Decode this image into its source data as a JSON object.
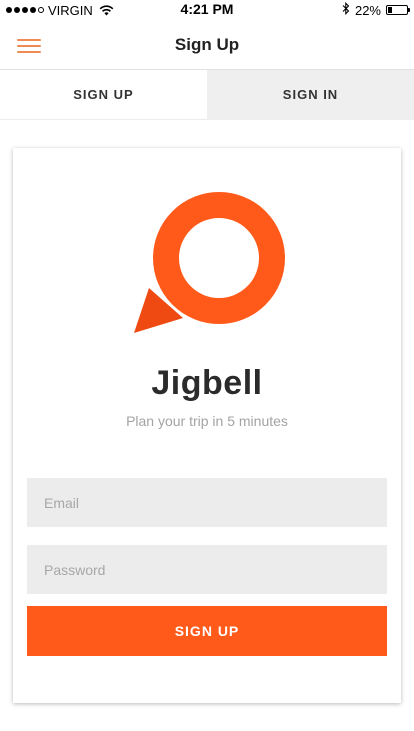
{
  "status_bar": {
    "carrier": "VIRGIN",
    "time": "4:21 PM",
    "battery_percent": "22%",
    "battery_level": 0.22,
    "signal_bars": 4,
    "signal_total": 5,
    "icons": [
      "signal-dots-icon",
      "wifi-icon",
      "bluetooth-icon",
      "battery-icon"
    ]
  },
  "nav": {
    "title": "Sign Up",
    "menu_icon": "hamburger-menu-icon",
    "accent_color": "#f08a55"
  },
  "tabs": [
    {
      "label": "SIGN UP",
      "active": true
    },
    {
      "label": "SIGN IN",
      "active": false
    }
  ],
  "card": {
    "logo_icon": "speech-bubble-logo-icon",
    "app_name": "Jigbell",
    "tagline": "Plan your trip in 5 minutes",
    "email_placeholder": "Email",
    "email_value": "",
    "password_placeholder": "Password",
    "password_value": "",
    "submit_label": "SIGN UP"
  },
  "colors": {
    "brand": "#ff5a19",
    "field_background": "#ececec",
    "inactive_tab": "#efefef"
  }
}
